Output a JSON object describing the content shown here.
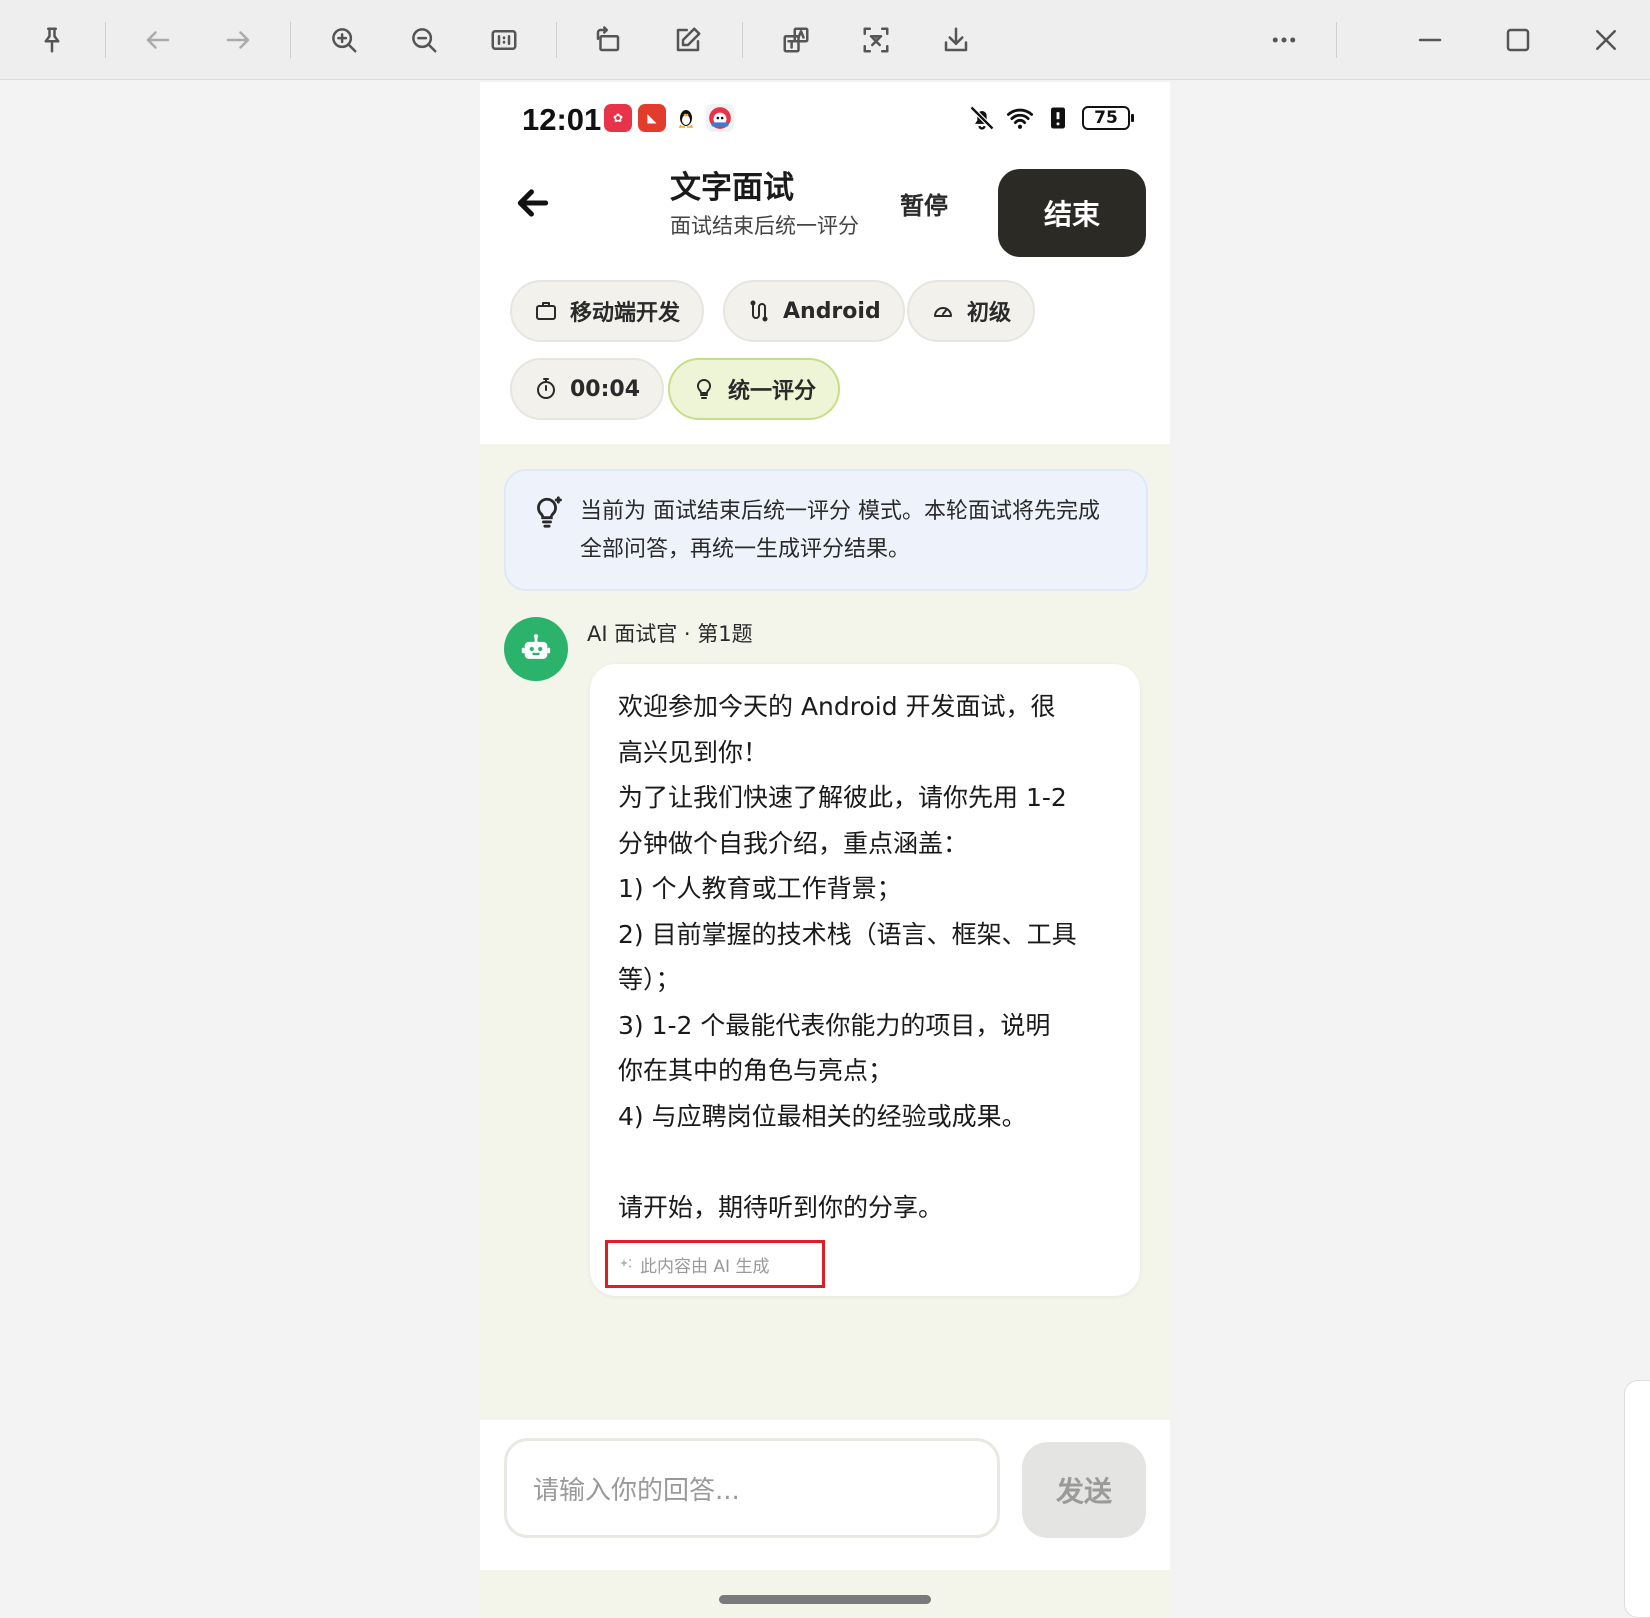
{
  "viewer_toolbar": {
    "buttons": [
      "pin-icon",
      "back-arrow-icon",
      "forward-arrow-icon",
      "zoom-in-icon",
      "zoom-out-icon",
      "actual-size-icon",
      "rotate-icon",
      "edit-icon",
      "translate-icon",
      "ocr-icon",
      "download-icon",
      "more-icon",
      "minimize-icon",
      "maximize-icon",
      "close-icon"
    ]
  },
  "status_bar": {
    "time": "12:01",
    "battery": "75"
  },
  "header": {
    "title": "文字面试",
    "subtitle": "面试结束后统一评分",
    "pause_label": "暂停",
    "end_label": "结束"
  },
  "chips": {
    "field": "移动端开发",
    "platform": "Android",
    "level": "初级",
    "timer": "00:04",
    "mode": "统一评分"
  },
  "notice": {
    "text": "当前为 面试结束后统一评分 模式。本轮面试将先完成全部问答，再统一生成评分结果。"
  },
  "message": {
    "meta": "AI 面试官 · 第1题",
    "body": "欢迎参加今天的 Android 开发面试，很\n高兴见到你！\n为了让我们快速了解彼此，请你先用 1-2\n分钟做个自我介绍，重点涵盖：\n1) 个人教育或工作背景；\n2) 目前掌握的技术栈（语言、框架、工具\n等）；\n3) 1-2 个最能代表你能力的项目，说明\n你在其中的角色与亮点；\n4) 与应聘岗位最相关的经验或成果。\n\n请开始，期待听到你的分享。",
    "ai_tag": "此内容由 AI 生成"
  },
  "input": {
    "placeholder": "请输入你的回答...",
    "send_label": "发送"
  },
  "colors": {
    "end_button": "#2b2a24",
    "avatar": "#2cb36b",
    "active_chip": "#eef5d6",
    "notice_bg": "#eef3fb",
    "highlight_box": "#e01c24"
  }
}
